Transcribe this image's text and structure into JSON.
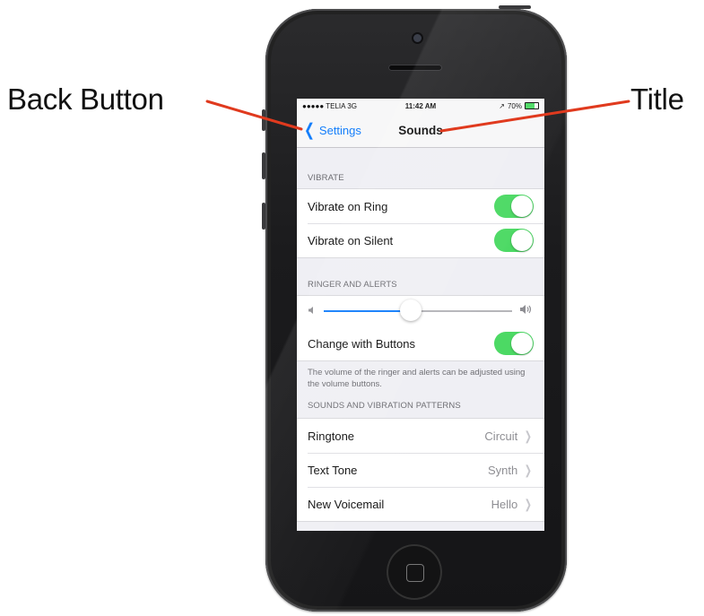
{
  "callouts": {
    "back_button": "Back Button",
    "title": "Title"
  },
  "status_bar": {
    "carrier": "●●●●● TELIA  3G",
    "time": "11:42 AM",
    "location": "↗",
    "battery_percent": "70%",
    "battery_level": 0.7
  },
  "nav": {
    "back_label": "Settings",
    "title": "Sounds"
  },
  "vibrate": {
    "header": "VIBRATE",
    "rows": [
      {
        "label": "Vibrate on Ring",
        "on": true
      },
      {
        "label": "Vibrate on Silent",
        "on": true
      }
    ]
  },
  "ringer": {
    "header": "RINGER AND ALERTS",
    "volume_level": 0.46,
    "change_with_buttons_label": "Change with Buttons",
    "change_with_buttons_on": true,
    "footer": "The volume of the ringer and alerts can be adjusted using the volume buttons."
  },
  "sounds": {
    "header": "SOUNDS AND VIBRATION PATTERNS",
    "rows": [
      {
        "label": "Ringtone",
        "value": "Circuit"
      },
      {
        "label": "Text Tone",
        "value": "Synth"
      },
      {
        "label": "New Voicemail",
        "value": "Hello"
      }
    ]
  },
  "colors": {
    "accent": "#147efb",
    "toggle_on": "#4cd964",
    "callout_arrow": "#e03a1e"
  }
}
